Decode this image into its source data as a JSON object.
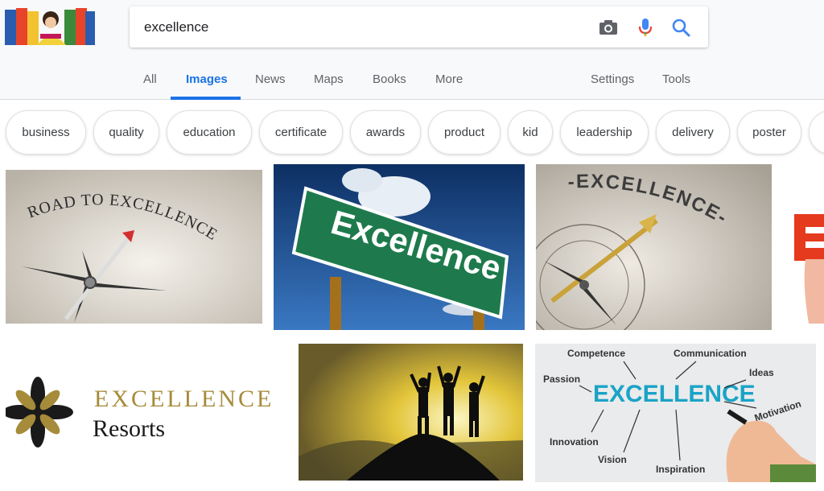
{
  "search": {
    "query": "excellence"
  },
  "tabs": [
    "All",
    "Images",
    "News",
    "Maps",
    "Books",
    "More"
  ],
  "active_tab": "Images",
  "tools": [
    "Settings",
    "Tools"
  ],
  "chips": [
    "business",
    "quality",
    "education",
    "certificate",
    "awards",
    "product",
    "kid",
    "leadership",
    "delivery",
    "poster"
  ],
  "images": {
    "road": {
      "text": "ROAD TO EXCELLENCE"
    },
    "sign": {
      "text": "Excellence"
    },
    "compass": {
      "text": "-EXCELLENCE-"
    },
    "resorts": {
      "line1": "EXCELLENCE",
      "line2": "Resorts"
    },
    "mind": {
      "center": "EXCELLENCE",
      "words": [
        "Competence",
        "Communication",
        "Passion",
        "Ideas",
        "Motivation",
        "Innovation",
        "Vision",
        "Inspiration"
      ]
    }
  },
  "colors": {
    "accent": "#1a73e8",
    "sign_green": "#1e7a4c",
    "gold": "#a68b3a"
  }
}
